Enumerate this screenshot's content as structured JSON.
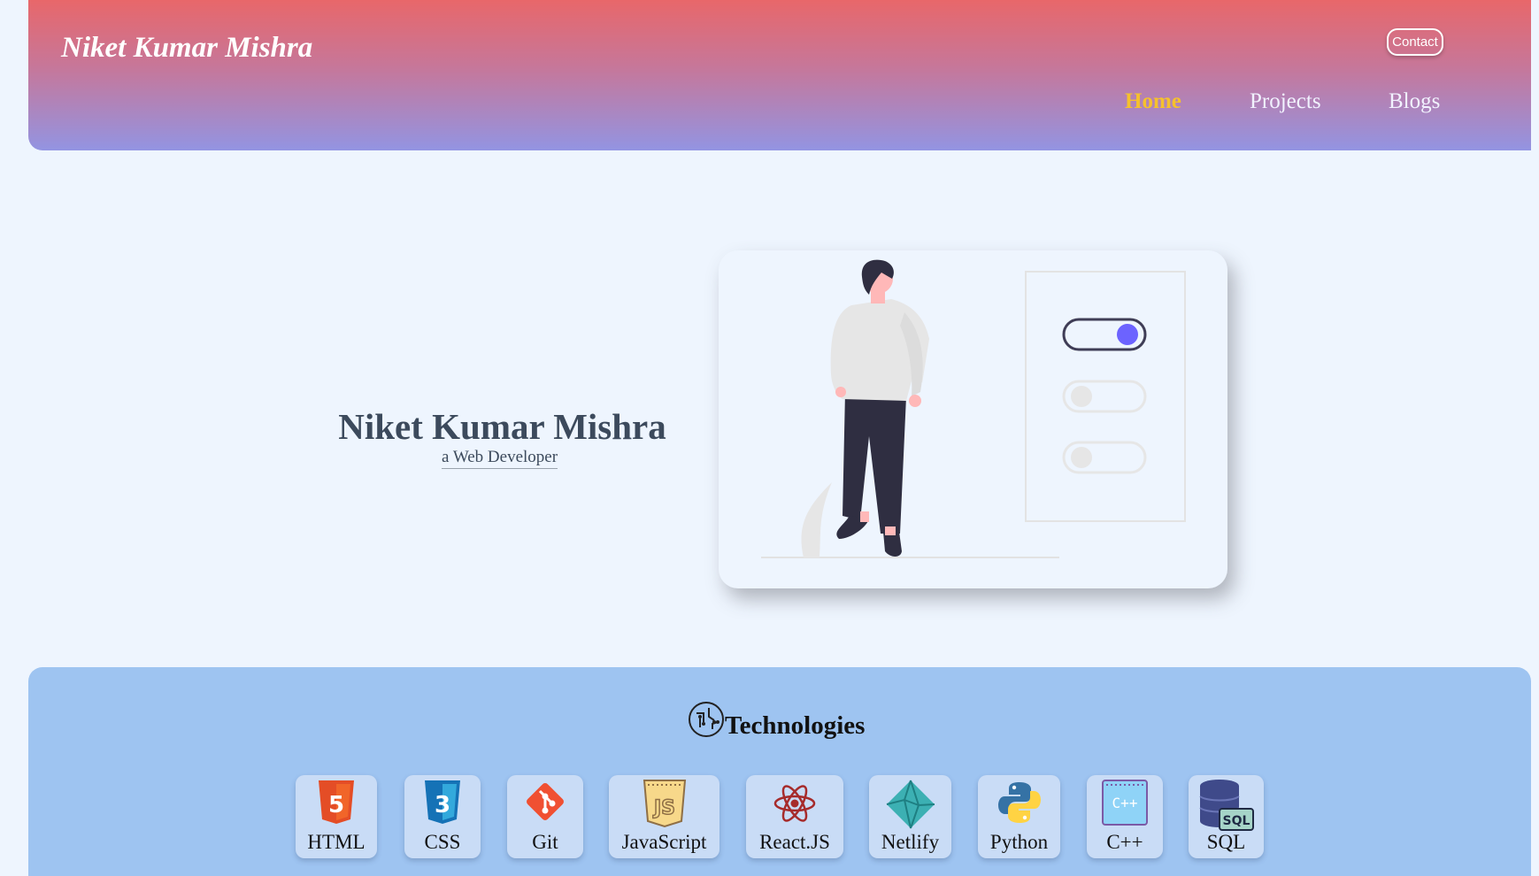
{
  "header": {
    "brand": "Niket Kumar Mishra",
    "contact_label": "Contact",
    "nav": [
      {
        "label": "Home",
        "active": true
      },
      {
        "label": "Projects",
        "active": false
      },
      {
        "label": "Blogs",
        "active": false
      }
    ]
  },
  "hero": {
    "name": "Niket Kumar Mishra",
    "role": "a Web Developer"
  },
  "technologies": {
    "title": "Technologies",
    "items": [
      {
        "label": "HTML",
        "icon": "html5-icon"
      },
      {
        "label": "CSS",
        "icon": "css3-icon"
      },
      {
        "label": "Git",
        "icon": "git-icon"
      },
      {
        "label": "JavaScript",
        "icon": "javascript-icon"
      },
      {
        "label": "React.JS",
        "icon": "react-icon"
      },
      {
        "label": "Netlify",
        "icon": "netlify-icon"
      },
      {
        "label": "Python",
        "icon": "python-icon"
      },
      {
        "label": "C++",
        "icon": "cpp-icon"
      },
      {
        "label": "SQL",
        "icon": "sql-database-icon"
      }
    ]
  },
  "colors": {
    "header_top": "#e8676a",
    "header_bottom": "#9394e2",
    "nav_active": "#f6c12c",
    "page_bg": "#eef5fe",
    "panel_bg": "#9ec4f1",
    "toggle_on": "#6c63ff"
  }
}
